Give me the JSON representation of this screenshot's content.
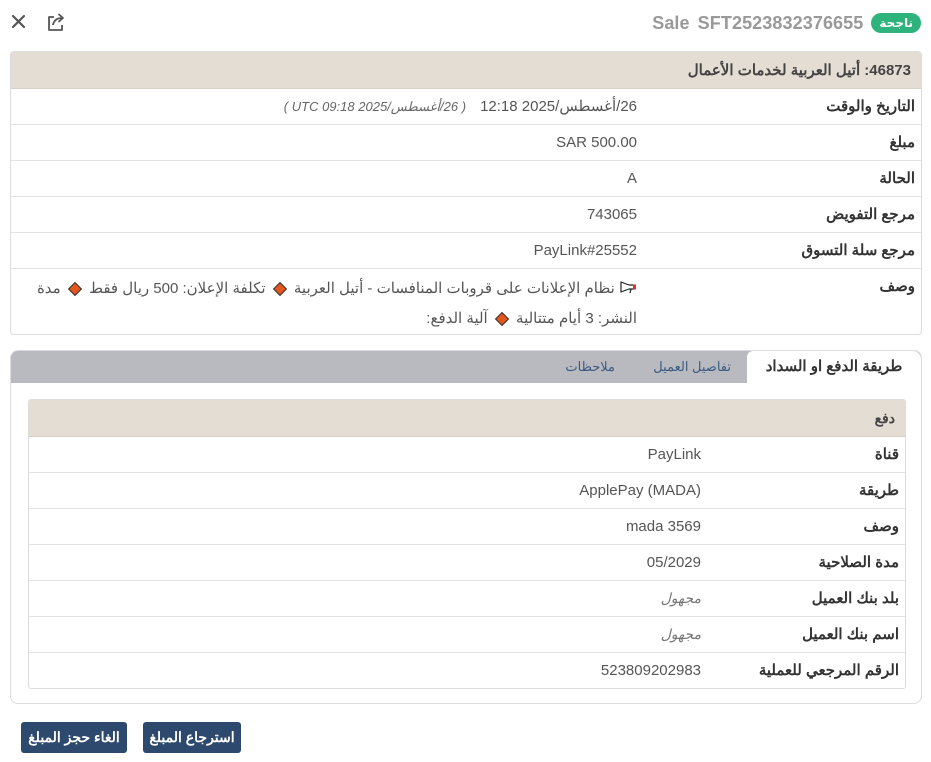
{
  "header": {
    "type_label": "Sale",
    "transaction_id": "SFT2523832376655",
    "status_badge": "ناجحة"
  },
  "icons": {
    "close": "close-icon",
    "share": "share-icon",
    "megaphone": "megaphone-icon",
    "diamond": "orange-diamond-icon"
  },
  "details": {
    "merchant_heading": "46873: أتيل العربية لخدمات الأعمال",
    "rows": [
      {
        "label": "التاريخ والوقت",
        "value": "26/أغسطس/2025 12:18",
        "secondary": "( 26/أغسطس/2025 09:18 UTC )"
      },
      {
        "label": "مبلغ",
        "value": "SAR 500.00"
      },
      {
        "label": "الحالة",
        "value": "A"
      },
      {
        "label": "مرجع التفويض",
        "value": "743065"
      },
      {
        "label": "مرجع سلة التسوق",
        "value": "PayLink#25552"
      }
    ],
    "description": {
      "label": "وصف",
      "part1": "نظام الإعلانات على قروبات المنافسات - أتيل العربية",
      "part2": "تكلفة الإعلان: 500 ريال فقط",
      "part3": "مدة النشر: 3 أيام متتالية",
      "part4": "آلية الدفع:"
    }
  },
  "tabs": {
    "items": [
      {
        "label": "طريقة الدفع او السداد"
      },
      {
        "label": "تفاصيل العميل"
      },
      {
        "label": "ملاحظات"
      }
    ],
    "active_index": 0
  },
  "payment": {
    "heading": "دفع",
    "rows": [
      {
        "label": "قناة",
        "value": "PayLink"
      },
      {
        "label": "طريقة",
        "value": "ApplePay (MADA)"
      },
      {
        "label": "وصف",
        "value": "mada 3569"
      },
      {
        "label": "مدة الصلاحية",
        "value": "05/2029"
      },
      {
        "label": "بلد بنك العميل",
        "value": "مجهول"
      },
      {
        "label": "اسم بنك العميل",
        "value": "مجهول"
      },
      {
        "label": "الرقم المرجعي للعملية",
        "value": "523809202983"
      }
    ]
  },
  "actions": {
    "cancel_hold": "الغاء حجز المبلغ",
    "refund": "استرجاع المبلغ"
  },
  "colors": {
    "status_success": "#2fb37c",
    "header_bg": "#e4ddd4",
    "tab_bar_bg": "#b9b9c0",
    "primary_button": "#2d4a6e",
    "diamond": "#e3571f"
  }
}
